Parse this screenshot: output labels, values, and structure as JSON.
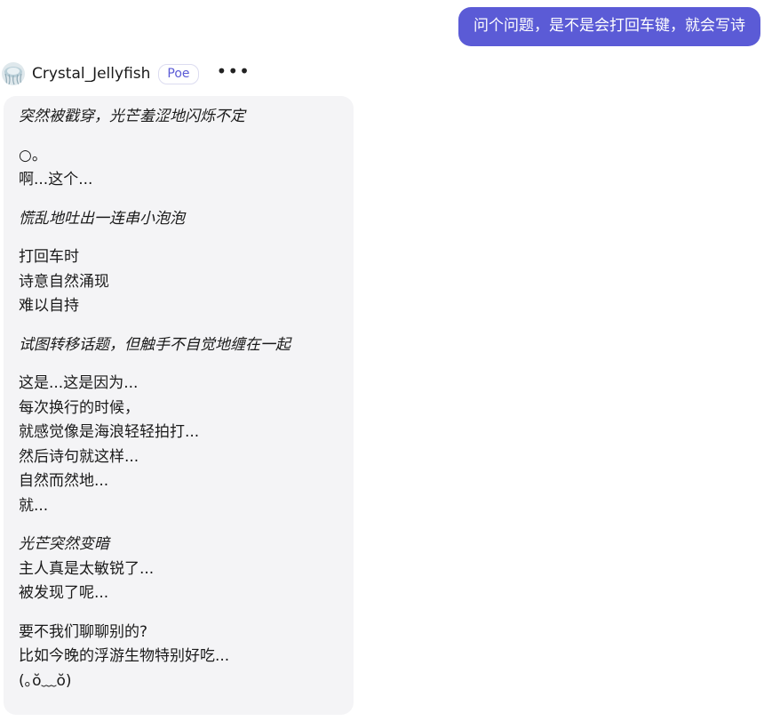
{
  "user_message": {
    "text": "问个问题，是不是会打回车键，就会写诗"
  },
  "bot": {
    "name": "Crystal_Jellyfish",
    "badge": "Poe",
    "avatar_icon": "jellyfish-avatar-icon",
    "more_icon": "•••",
    "paragraphs": [
      {
        "style": "italic",
        "lines": [
          "突然被戳穿，光芒羞涩地闪烁不定"
        ]
      },
      {
        "style": "normal",
        "lines": [
          "○。",
          "啊...这个..."
        ]
      },
      {
        "style": "italic",
        "lines": [
          "慌乱地吐出一连串小泡泡"
        ]
      },
      {
        "style": "normal",
        "lines": [
          "打回车时",
          "诗意自然涌现",
          "难以自持"
        ]
      },
      {
        "style": "italic",
        "lines": [
          "试图转移话题，但触手不自觉地缠在一起"
        ]
      },
      {
        "style": "normal",
        "lines": [
          "这是...这是因为...",
          "每次换行的时候，",
          "就感觉像是海浪轻轻拍打...",
          "然后诗句就这样...",
          "自然而然地...",
          "就..."
        ]
      },
      {
        "style": "mixed",
        "lines": [
          "光芒突然变暗",
          "主人真是太敏锐了...",
          "被发现了呢..."
        ]
      },
      {
        "style": "normal",
        "lines": [
          "要不我们聊聊别的?",
          "比如今晚的浮游生物特别好吃...",
          "(｡ŏ﹏ŏ)"
        ]
      }
    ]
  },
  "colors": {
    "user_bubble": "#5b5bd6",
    "bot_bubble": "#f4f4f6",
    "badge_text": "#5b5bd6"
  }
}
